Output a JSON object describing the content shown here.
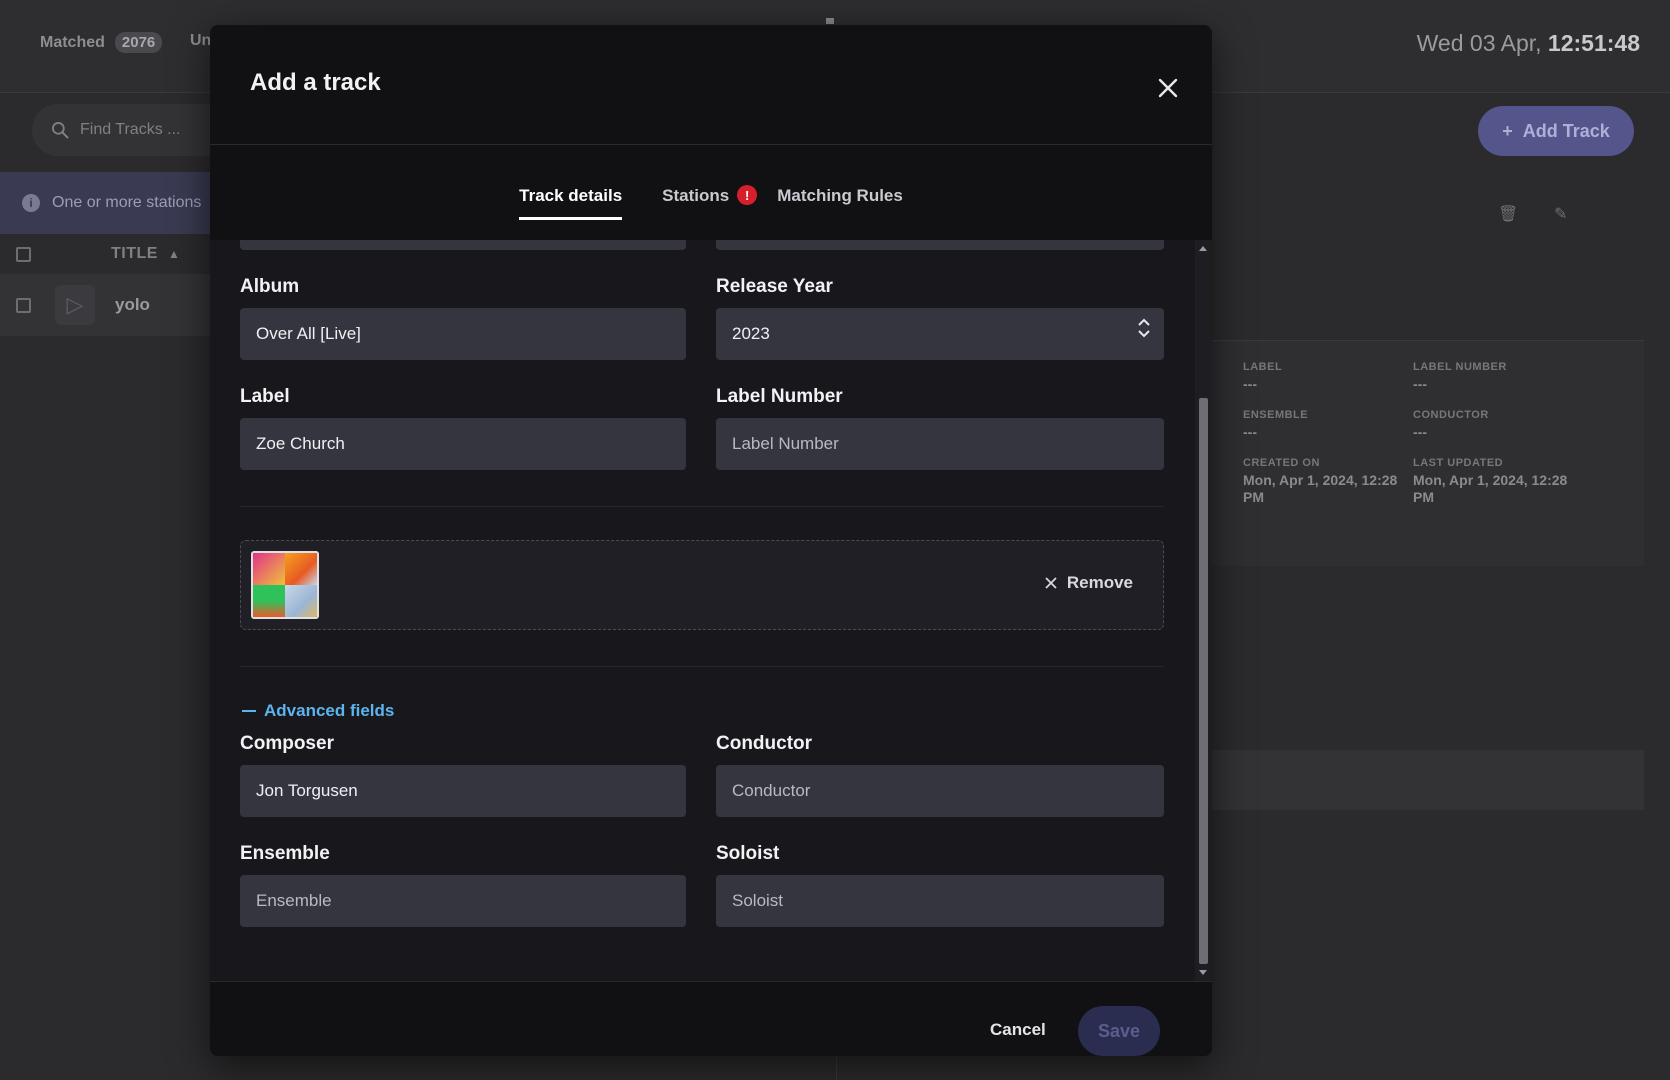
{
  "background": {
    "tabs": {
      "matched_label": "Matched",
      "matched_count": "2076",
      "unmatched_label": "Un"
    },
    "clock": {
      "date": "Wed 03 Apr,",
      "time": "12:51:48"
    },
    "search": {
      "placeholder": "Find Tracks ..."
    },
    "banner": {
      "text": "One or more stations"
    },
    "table": {
      "header_title": "TITLE",
      "row_title": "yolo"
    },
    "add_track_label": "Add Track",
    "details": {
      "label_key": "LABEL",
      "label_value": "---",
      "label_number_key": "LABEL NUMBER",
      "label_number_value": "---",
      "ensemble_key": "ENSEMBLE",
      "ensemble_value": "---",
      "conductor_key": "CONDUCTOR",
      "conductor_value": "---",
      "created_key": "CREATED ON",
      "created_value": "Mon, Apr 1, 2024, 12:28 PM",
      "updated_key": "LAST UPDATED",
      "updated_value": "Mon, Apr 1, 2024, 12:28 PM"
    }
  },
  "modal": {
    "title": "Add a track",
    "tabs": [
      {
        "label": "Track details",
        "active": true
      },
      {
        "label": "Stations",
        "badge": "!"
      },
      {
        "label": "Matching Rules"
      }
    ],
    "fields": {
      "album": {
        "label": "Album",
        "value": "Over All [Live]"
      },
      "release_year": {
        "label": "Release Year",
        "value": "2023"
      },
      "label": {
        "label": "Label",
        "value": "Zoe Church"
      },
      "label_number": {
        "label": "Label Number",
        "placeholder": "Label Number"
      },
      "composer": {
        "label": "Composer",
        "value": "Jon Torgusen"
      },
      "conductor": {
        "label": "Conductor",
        "placeholder": "Conductor"
      },
      "ensemble": {
        "label": "Ensemble",
        "placeholder": "Ensemble"
      },
      "soloist": {
        "label": "Soloist",
        "placeholder": "Soloist"
      }
    },
    "artwork": {
      "remove_label": "Remove"
    },
    "advanced_fields_label": "Advanced fields",
    "footer": {
      "cancel_label": "Cancel",
      "save_label": "Save"
    }
  },
  "colors": {
    "accent_link": "#5cb3ee",
    "badge_error": "#d61f2b",
    "primary_button": "#54558a",
    "modal_bg": "#111114",
    "input_bg": "#35353f"
  }
}
